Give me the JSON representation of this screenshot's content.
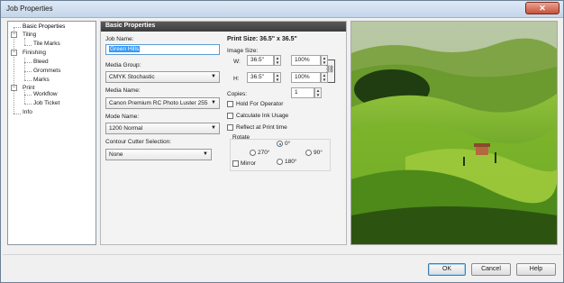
{
  "window": {
    "title": "Job Properties",
    "close_glyph": "✕"
  },
  "tree": {
    "items": [
      {
        "label": "Basic Properties",
        "toggle": ""
      },
      {
        "label": "Tiling",
        "toggle": "−"
      },
      {
        "label": "Tile Marks",
        "toggle": ""
      },
      {
        "label": "Finishing",
        "toggle": "−"
      },
      {
        "label": "Bleed",
        "toggle": ""
      },
      {
        "label": "Grommets",
        "toggle": ""
      },
      {
        "label": "Marks",
        "toggle": ""
      },
      {
        "label": "Print",
        "toggle": "−"
      },
      {
        "label": "Workflow",
        "toggle": ""
      },
      {
        "label": "Job Ticket",
        "toggle": ""
      },
      {
        "label": "Info",
        "toggle": ""
      }
    ]
  },
  "panel": {
    "header": "Basic Properties",
    "job_name_label": "Job Name:",
    "job_name_value": "Green Hills",
    "media_group_label": "Media Group:",
    "media_group_value": "CMYK Stochastic",
    "media_name_label": "Media Name:",
    "media_name_value": "Canon Premium RC Photo Luster 255",
    "mode_name_label": "Mode Name:",
    "mode_name_value": "1200 Normal",
    "contour_label": "Contour Cutter Selection:",
    "contour_value": "None",
    "print_size": "Print Size: 36.5\" x 36.5\"",
    "image_size_label": "Image Size:",
    "w_label": "W:",
    "w_value": "36.5\"",
    "w_percent": "100%",
    "h_label": "H:",
    "h_value": "36.5\"",
    "h_percent": "100%",
    "copies_label": "Copies:",
    "copies_value": "1",
    "hold_label": "Hold For Operator",
    "calc_label": "Calculate Ink Usage",
    "reflect_label": "Reflect at Print time",
    "rotate_label": "Rotate",
    "rot_0": "0°",
    "rot_270": "270°",
    "rot_90": "90°",
    "rot_180": "180°",
    "mirror_label": "Mirror",
    "selected_rotation": "0°"
  },
  "buttons": {
    "ok": "OK",
    "cancel": "Cancel",
    "help": "Help"
  },
  "colors": {
    "header_bg": "#464646",
    "selection": "#3399ff"
  },
  "icons": {
    "spin_up": "▲",
    "spin_down": "▼",
    "dropdown": "▼",
    "link": "🔗"
  }
}
